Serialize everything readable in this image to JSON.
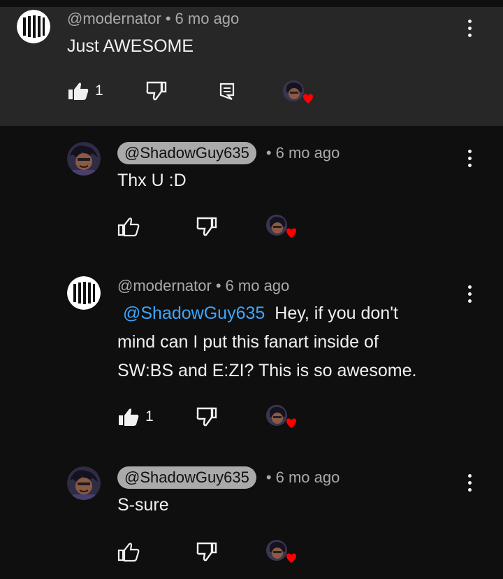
{
  "comments": [
    {
      "handle": "@modernator",
      "time": "6 mo ago",
      "text": "Just AWESOME",
      "likes": "1",
      "author_type": "modernator",
      "handle_chip": false,
      "liked": true,
      "has_reply_button": true
    },
    {
      "handle": "@ShadowGuy635",
      "time": "6 mo ago",
      "text": "Thx U :D",
      "likes": "",
      "author_type": "shadowguy",
      "handle_chip": true,
      "liked": false,
      "has_reply_button": false
    },
    {
      "handle": "@modernator",
      "time": "6 mo ago",
      "mention": "@ShadowGuy635",
      "text_line1": "Hey, if you don't",
      "text_line2": "mind can I put this fanart inside of",
      "text_line3": "SW:BS and E:ZI? This is so awesome.",
      "likes": "1",
      "author_type": "modernator",
      "handle_chip": false,
      "liked": true,
      "has_reply_button": false
    },
    {
      "handle": "@ShadowGuy635",
      "time": "6 mo ago",
      "text": "S-sure",
      "likes": "",
      "author_type": "shadowguy",
      "handle_chip": true,
      "liked": false,
      "has_reply_button": false
    }
  ],
  "separator": "•",
  "icons": {
    "like": "thumbs-up-icon",
    "dislike": "thumbs-down-icon",
    "reply": "reply-icon",
    "more": "more-vertical-icon",
    "creator_heart": "creator-heart-icon"
  },
  "colors": {
    "background": "#0f0f0f",
    "highlight": "#272727",
    "mention": "#3ea6ff",
    "heart": "#ff0000"
  }
}
